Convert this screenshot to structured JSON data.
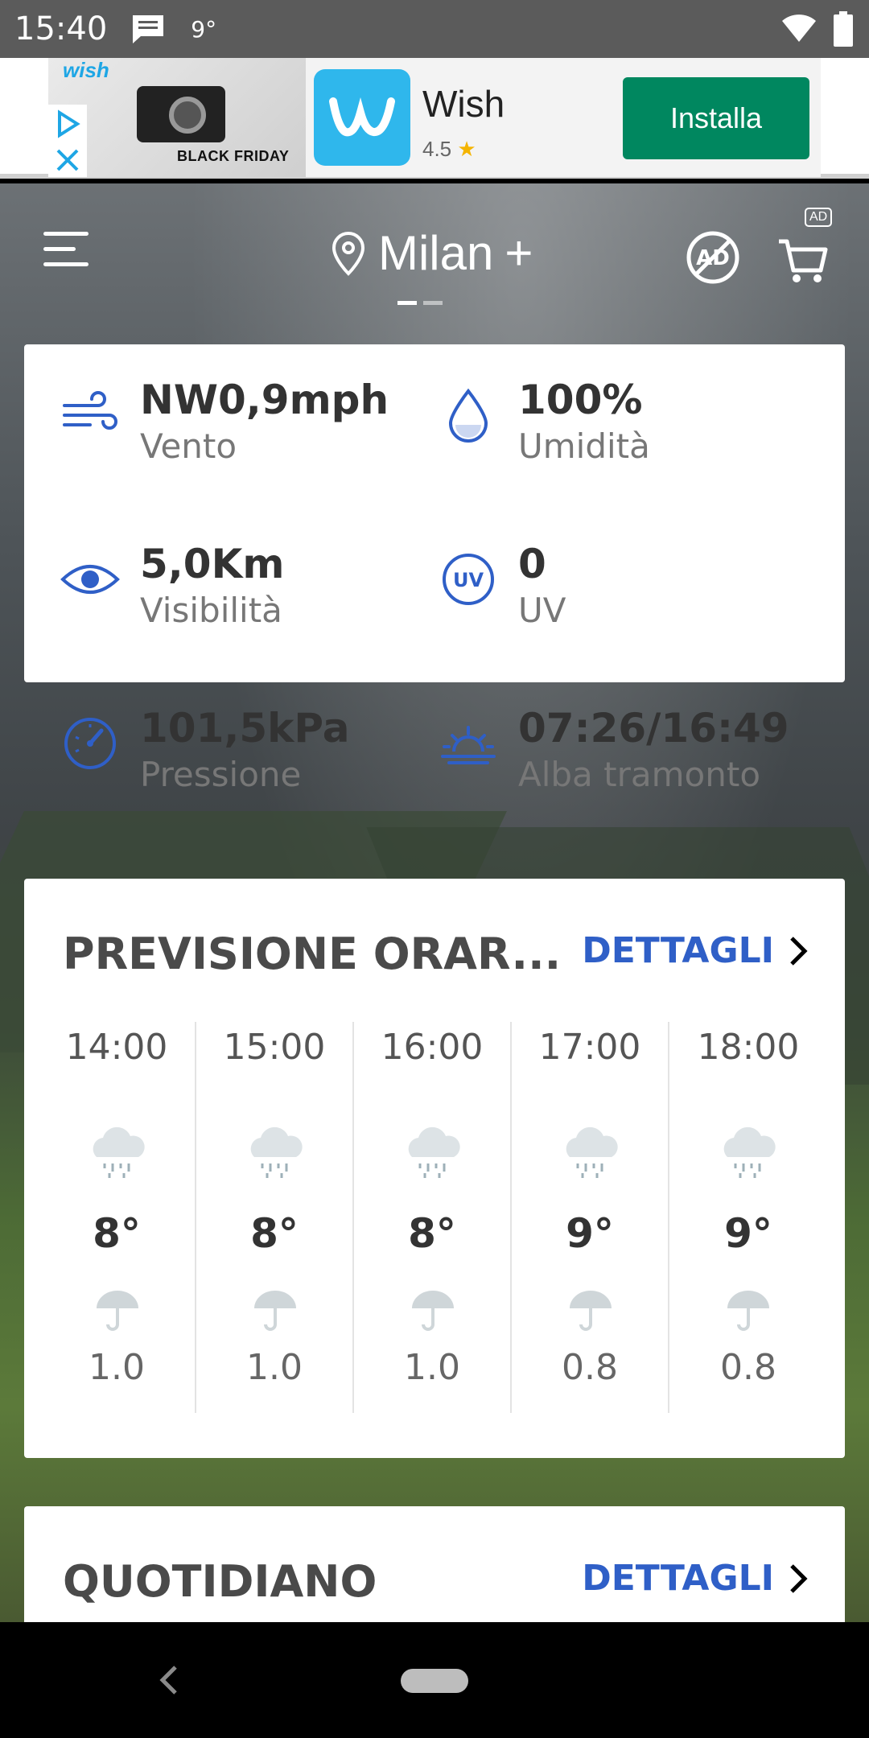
{
  "status_bar": {
    "time": "15:40",
    "temp": "9°"
  },
  "ad": {
    "brand_small": "wish",
    "image_caption": "BLACK FRIDAY",
    "app_name": "Wish",
    "rating": "4.5",
    "rating_star": "★",
    "install_label": "Installa"
  },
  "header": {
    "city": "Milan",
    "add_symbol": "+",
    "ad_badge": "AD"
  },
  "details": [
    {
      "value": "NW0,9mph",
      "label": "Vento",
      "icon": "wind-icon"
    },
    {
      "value": "100%",
      "label": "Umidità",
      "icon": "humidity-drop-icon"
    },
    {
      "value": "5,0Km",
      "label": "Visibilità",
      "icon": "eye-icon"
    },
    {
      "value": "0",
      "label": "UV",
      "icon": "uv-icon"
    },
    {
      "value": "101,5kPa",
      "label": "Pressione",
      "icon": "gauge-icon"
    },
    {
      "value": "07:26/16:49",
      "label": "Alba tramonto",
      "icon": "sunrise-icon"
    }
  ],
  "hourly": {
    "title": "PREVISIONE ORAR...",
    "details_label": "DETTAGLI",
    "hours": [
      {
        "time": "14:00",
        "temp": "8°",
        "precip": "1.0"
      },
      {
        "time": "15:00",
        "temp": "8°",
        "precip": "1.0"
      },
      {
        "time": "16:00",
        "temp": "8°",
        "precip": "1.0"
      },
      {
        "time": "17:00",
        "temp": "9°",
        "precip": "0.8"
      },
      {
        "time": "18:00",
        "temp": "9°",
        "precip": "0.8"
      }
    ]
  },
  "daily": {
    "title": "QUOTIDIANO",
    "details_label": "DETTAGLI"
  },
  "colors": {
    "accent": "#2f5fc7",
    "install": "#00875f"
  }
}
